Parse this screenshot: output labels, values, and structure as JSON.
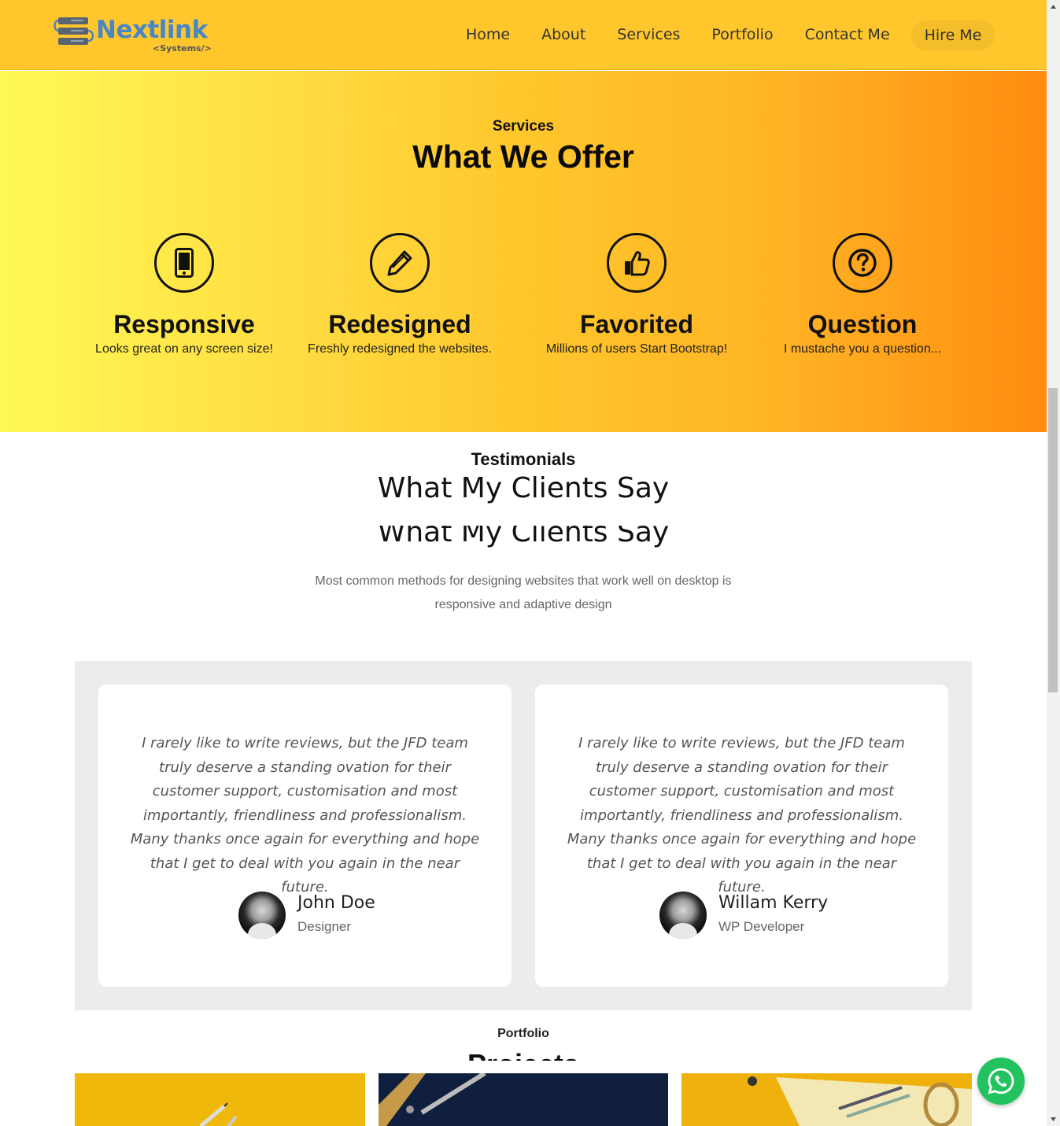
{
  "header": {
    "logo_text": "Nextlink",
    "logo_sub": "<Systems/>",
    "nav": [
      "Home",
      "About",
      "Services",
      "Portfolio",
      "Contact Me"
    ],
    "cta": "Hire Me"
  },
  "services": {
    "kicker": "Services",
    "title": "What We Offer",
    "items": [
      {
        "icon": "mobile-icon",
        "title": "Responsive",
        "text": "Looks great on any screen size!"
      },
      {
        "icon": "pencil-icon",
        "title": "Redesigned",
        "text": "Freshly redesigned the websites."
      },
      {
        "icon": "thumbs-up-icon",
        "title": "Favorited",
        "text": "Millions of users Start Bootstrap!"
      },
      {
        "icon": "question-icon",
        "title": "Question",
        "text": "I mustache you a question..."
      }
    ]
  },
  "testimonials": {
    "kicker": "Testimonials",
    "title": "What My Clients Say",
    "title_repeat": "What My Clients Say",
    "description": "Most common methods for designing websites that work well on desktop is responsive and adaptive design",
    "cards": [
      {
        "quote": "I rarely like to write reviews, but the JFD team truly deserve a standing ovation for their customer support, customisation and most importantly, friendliness and professionalism. Many thanks once again for everything and hope that I get to deal with you again in the near future.",
        "name": "John Doe",
        "role": "Designer"
      },
      {
        "quote": "I rarely like to write reviews, but the JFD team truly deserve a standing ovation for their customer support, customisation and most importantly, friendliness and professionalism. Many thanks once again for everything and hope that I get to deal with you again in the near future.",
        "name": "Willam Kerry",
        "role": "WP Developer"
      }
    ]
  },
  "portfolio": {
    "kicker": "Portfolio",
    "title": "Projects"
  },
  "colors": {
    "header_bg": "#ffc72c",
    "gradient_start": "#fff954",
    "gradient_end": "#ff8c10",
    "whatsapp": "#22c35e",
    "logo": "#4a86c5"
  },
  "floating": {
    "icon": "whatsapp-icon"
  }
}
